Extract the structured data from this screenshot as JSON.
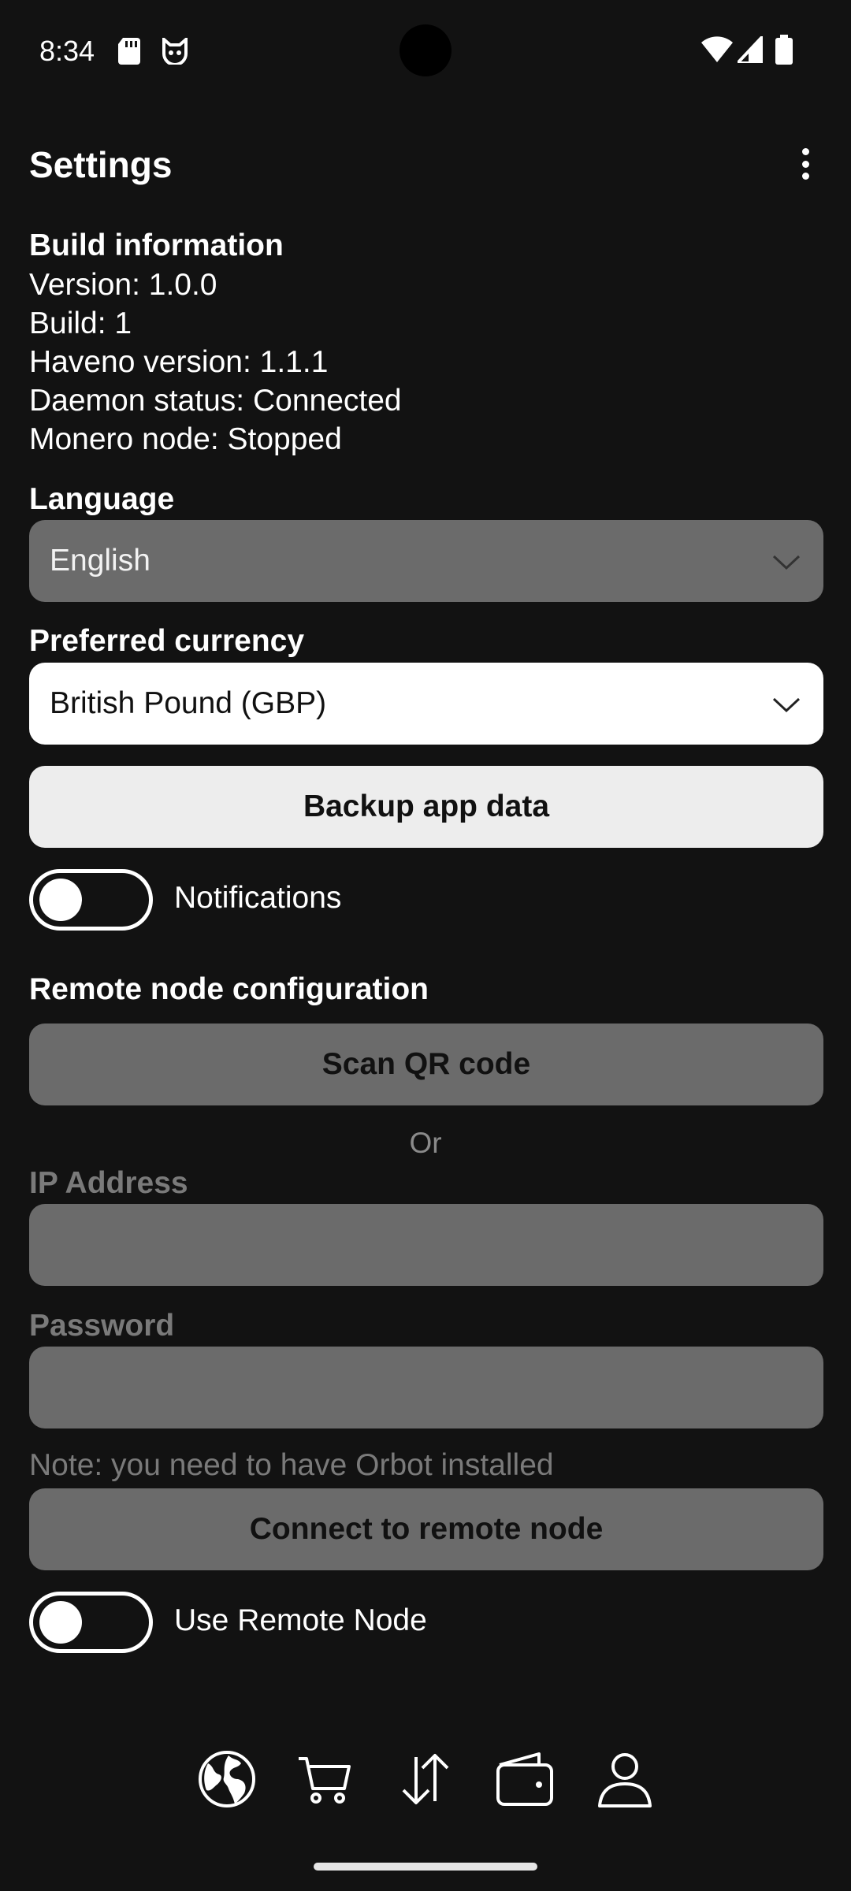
{
  "status": {
    "time": "8:34"
  },
  "header": {
    "title": "Settings"
  },
  "build": {
    "heading": "Build information",
    "lines": [
      "Version: 1.0.0",
      "Build: 1",
      "Haveno version: 1.1.1",
      "Daemon status: Connected",
      "Monero node: Stopped"
    ]
  },
  "language": {
    "label": "Language",
    "value": "English"
  },
  "currency": {
    "label": "Preferred currency",
    "value": "British Pound (GBP)"
  },
  "backup": {
    "label": "Backup app data"
  },
  "notifications": {
    "label": "Notifications",
    "enabled": false
  },
  "remote": {
    "heading": "Remote node configuration",
    "scan_label": "Scan QR code",
    "or_text": "Or",
    "ip_label": "IP Address",
    "ip_value": "",
    "password_label": "Password",
    "password_value": "",
    "note": "Note: you need to have Orbot installed",
    "connect_label": "Connect to remote node",
    "use_remote_label": "Use Remote Node",
    "use_remote_enabled": false
  },
  "nav": {
    "items": [
      "globe-icon",
      "cart-icon",
      "transfer-icon",
      "wallet-icon",
      "profile-icon"
    ]
  },
  "colors": {
    "background": "#121212",
    "disabled": "#6b6b6b",
    "button_light": "#ededed"
  }
}
